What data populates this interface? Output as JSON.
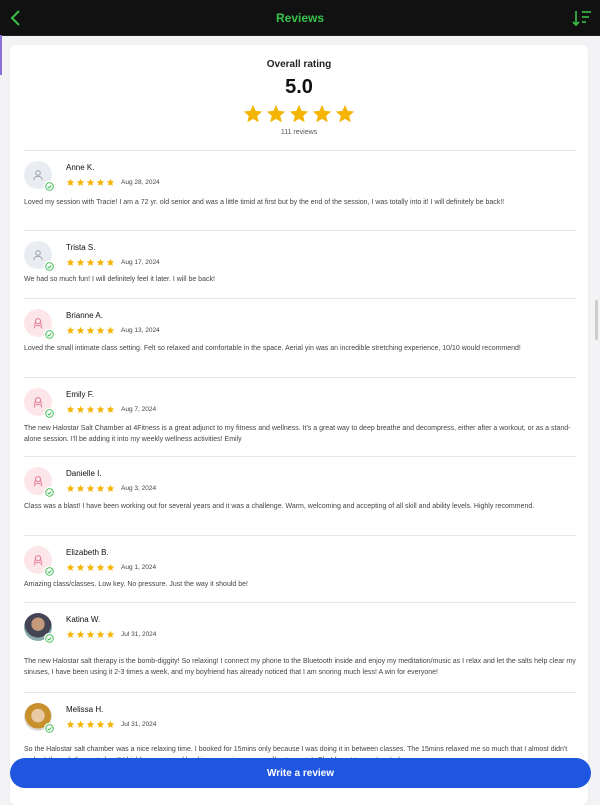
{
  "header": {
    "title": "Reviews",
    "back_icon": "chevron-left-icon",
    "sort_icon": "sort-descending-icon",
    "accent": "#39c24a"
  },
  "summary": {
    "label": "Overall rating",
    "score": "5.0",
    "stars": 5,
    "count": "111 reviews",
    "star_color": "#f5b400"
  },
  "reviews": [
    {
      "name": "Anne K.",
      "rating": 5,
      "date": "Aug 28, 2024",
      "avatar": "gray",
      "text": "Loved my session with Tracie! I am a 72 yr. old senior and was a little timid at first but by the end of the session, I was totally into it! I will definitely be back!!"
    },
    {
      "name": "Trista S.",
      "rating": 5,
      "date": "Aug 17, 2024",
      "avatar": "gray",
      "text": "We had so much fun! I will definitely feel it later. I will be back!"
    },
    {
      "name": "Brianne A.",
      "rating": 5,
      "date": "Aug 13, 2024",
      "avatar": "pink",
      "text": "Loved the small intimate class setting. Felt so relaxed and comfortable in the space. Aerial yin was an incredible stretching experience, 10/10 would recommend!"
    },
    {
      "name": "Emily F.",
      "rating": 5,
      "date": "Aug 7, 2024",
      "avatar": "pink",
      "text": "The new Halostar Salt Chamber at 4Fitness is a great adjunct to my fitness and wellness. It's a great way to deep breathe and decompress, either after a workout, or as a stand-alone session. I'll be adding it into my weekly wellness activities! Emily"
    },
    {
      "name": "Danielle I.",
      "rating": 5,
      "date": "Aug 3, 2024",
      "avatar": "pink",
      "text": "Class was a blast! I have been working out for several years and it was a challenge. Warm, welcoming and accepting of all skill and ability levels. Highly recommend."
    },
    {
      "name": "Elizabeth B.",
      "rating": 5,
      "date": "Aug 1, 2024",
      "avatar": "pink",
      "text": "Amazing class/classes. Low key. No pressure. Just the way it should be!"
    },
    {
      "name": "Katina W.",
      "rating": 5,
      "date": "Jul 31, 2024",
      "avatar": "photo1",
      "text": "The new Halostar salt therapy is the bomb-diggity! So relaxing! I connect my phone to the Bluetooth inside and enjoy my meditation/music as I relax and let the salts help clear my sinuses, I have been using it 2-3 times a week, and my boyfriend has already noticed that I am snoring much less! A win for everyone!"
    },
    {
      "name": "Melissa H.",
      "rating": 5,
      "date": "Jul 31, 2024",
      "avatar": "photo2",
      "text": "So the Halostar salt chamber was a nice relaxing time. I booked for 15mins only because I was doing it in between classes. The 15mins relaxed me so much that I almost didn't make it through the next class!! I highly recommend booking a session as you will not regret it. Oh, I forgot to mention it also"
    }
  ],
  "footer": {
    "button_label": "Write a review",
    "button_color": "#1f56e0"
  }
}
